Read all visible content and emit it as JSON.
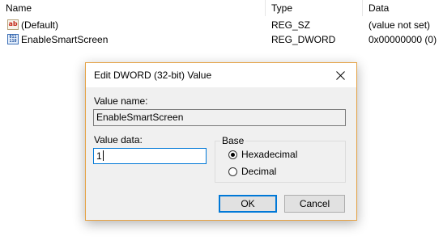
{
  "list": {
    "columns": [
      "Name",
      "Type",
      "Data"
    ],
    "rows": [
      {
        "icon": "string-value-icon",
        "icon_glyph": "ab",
        "name": "(Default)",
        "type": "REG_SZ",
        "data": "(value not set)"
      },
      {
        "icon": "binary-value-icon",
        "icon_glyph": "011 110",
        "name": "EnableSmartScreen",
        "type": "REG_DWORD",
        "data": "0x00000000 (0)"
      }
    ]
  },
  "dialog": {
    "title": "Edit DWORD (32-bit) Value",
    "close_icon": "close-icon",
    "value_name_label": "Value name:",
    "value_name": "EnableSmartScreen",
    "value_data_label": "Value data:",
    "value_data": "1",
    "base_label": "Base",
    "base_options": [
      {
        "label": "Hexadecimal",
        "checked": true
      },
      {
        "label": "Decimal",
        "checked": false
      }
    ],
    "ok_label": "OK",
    "cancel_label": "Cancel"
  },
  "colors": {
    "dialog_border": "#e5a245",
    "focus_blue": "#0078d7",
    "dialog_background": "#f0f0f0"
  }
}
